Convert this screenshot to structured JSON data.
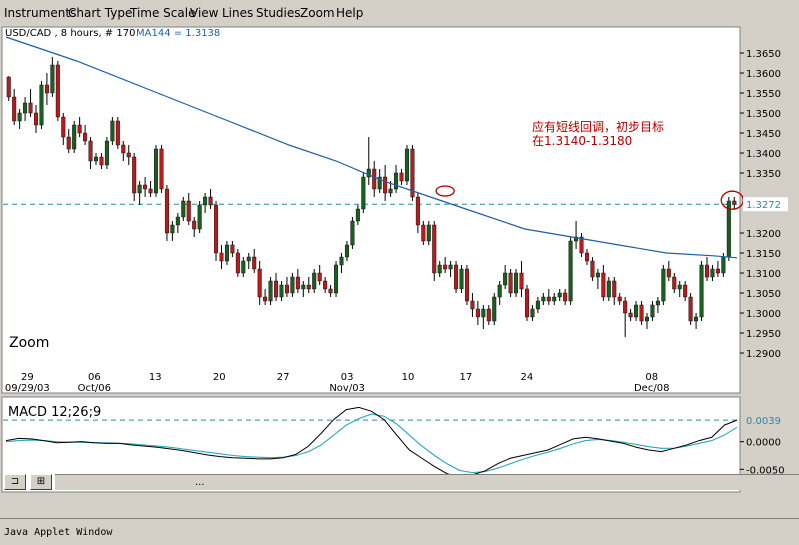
{
  "menu": [
    "Instruments",
    "Chart Type",
    "Time Scale",
    "View",
    "Lines",
    "Studies",
    "Zoom",
    "Help"
  ],
  "colors": {
    "up": "#1b5e20",
    "down": "#b71c1c",
    "wick": "#000000",
    "ma": "#1f5fa8",
    "signal": "#2aa7c0",
    "annotation": "#b00000",
    "hline": "#2a8aa0",
    "panel_bg": "#ffffff",
    "frame_bg": "#d4d0c8"
  },
  "chart_data": [
    {
      "type": "candlestick",
      "header": "USD/CAD , 8 hours, # 170",
      "ma_label": "MA144 = 1.3138",
      "zoom_label": "Zoom",
      "annotation_line1": "应有短线回调，初步目标",
      "annotation_line2": "在1.3140-1.3180",
      "ylim": [
        1.2865,
        1.37
      ],
      "yticks": [
        "1.3650",
        "1.3600",
        "1.3550",
        "1.3500",
        "1.3450",
        "1.3400",
        "1.3350",
        "1.3200",
        "1.3150",
        "1.3100",
        "1.3050",
        "1.3000",
        "1.2950",
        "1.2900"
      ],
      "last_price": 1.3272,
      "last_price_label": "1.3272",
      "x_day_labels": [
        "29",
        "06",
        "13",
        "20",
        "27",
        "03",
        "10",
        "17",
        "24",
        "08"
      ],
      "x_month_labels": [
        "09/29/03",
        "Oct/06",
        "Nov/03",
        "Dec/08"
      ],
      "candles": [
        [
          1.359,
          1.3592,
          1.353,
          1.354
        ],
        [
          1.354,
          1.356,
          1.347,
          1.348
        ],
        [
          1.348,
          1.351,
          1.346,
          1.35
        ],
        [
          1.35,
          1.354,
          1.348,
          1.3525
        ],
        [
          1.3525,
          1.356,
          1.349,
          1.35
        ],
        [
          1.35,
          1.352,
          1.345,
          1.347
        ],
        [
          1.347,
          1.358,
          1.346,
          1.357
        ],
        [
          1.357,
          1.36,
          1.352,
          1.355
        ],
        [
          1.355,
          1.364,
          1.354,
          1.362
        ],
        [
          1.362,
          1.363,
          1.348,
          1.349
        ],
        [
          1.349,
          1.35,
          1.342,
          1.344
        ],
        [
          1.344,
          1.346,
          1.34,
          1.341
        ],
        [
          1.341,
          1.348,
          1.34,
          1.347
        ],
        [
          1.347,
          1.349,
          1.344,
          1.345
        ],
        [
          1.345,
          1.347,
          1.342,
          1.343
        ],
        [
          1.343,
          1.344,
          1.336,
          1.338
        ],
        [
          1.338,
          1.34,
          1.337,
          1.339
        ],
        [
          1.339,
          1.34,
          1.336,
          1.337
        ],
        [
          1.337,
          1.344,
          1.336,
          1.343
        ],
        [
          1.343,
          1.349,
          1.342,
          1.348
        ],
        [
          1.348,
          1.349,
          1.341,
          1.342
        ],
        [
          1.342,
          1.343,
          1.338,
          1.34
        ],
        [
          1.34,
          1.342,
          1.337,
          1.339
        ],
        [
          1.339,
          1.34,
          1.328,
          1.33
        ],
        [
          1.33,
          1.333,
          1.327,
          1.332
        ],
        [
          1.332,
          1.334,
          1.329,
          1.331
        ],
        [
          1.331,
          1.333,
          1.329,
          1.33
        ],
        [
          1.33,
          1.342,
          1.329,
          1.341
        ],
        [
          1.341,
          1.342,
          1.33,
          1.331
        ],
        [
          1.331,
          1.332,
          1.318,
          1.32
        ],
        [
          1.32,
          1.323,
          1.318,
          1.322
        ],
        [
          1.322,
          1.325,
          1.32,
          1.324
        ],
        [
          1.324,
          1.329,
          1.323,
          1.328
        ],
        [
          1.328,
          1.33,
          1.322,
          1.323
        ],
        [
          1.323,
          1.324,
          1.319,
          1.321
        ],
        [
          1.321,
          1.328,
          1.32,
          1.327
        ],
        [
          1.327,
          1.33,
          1.325,
          1.329
        ],
        [
          1.329,
          1.331,
          1.326,
          1.327
        ],
        [
          1.327,
          1.328,
          1.313,
          1.315
        ],
        [
          1.315,
          1.317,
          1.311,
          1.313
        ],
        [
          1.313,
          1.318,
          1.312,
          1.317
        ],
        [
          1.317,
          1.318,
          1.314,
          1.315
        ],
        [
          1.315,
          1.316,
          1.309,
          1.31
        ],
        [
          1.31,
          1.314,
          1.309,
          1.313
        ],
        [
          1.313,
          1.315,
          1.311,
          1.314
        ],
        [
          1.314,
          1.316,
          1.31,
          1.311
        ],
        [
          1.311,
          1.313,
          1.302,
          1.304
        ],
        [
          1.304,
          1.306,
          1.302,
          1.303
        ],
        [
          1.303,
          1.309,
          1.302,
          1.308
        ],
        [
          1.308,
          1.31,
          1.303,
          1.304
        ],
        [
          1.304,
          1.308,
          1.303,
          1.307
        ],
        [
          1.307,
          1.309,
          1.304,
          1.305
        ],
        [
          1.305,
          1.31,
          1.304,
          1.309
        ],
        [
          1.309,
          1.311,
          1.305,
          1.306
        ],
        [
          1.306,
          1.308,
          1.304,
          1.307
        ],
        [
          1.307,
          1.309,
          1.305,
          1.306
        ],
        [
          1.306,
          1.311,
          1.305,
          1.31
        ],
        [
          1.31,
          1.312,
          1.307,
          1.308
        ],
        [
          1.308,
          1.309,
          1.305,
          1.306
        ],
        [
          1.306,
          1.307,
          1.304,
          1.305
        ],
        [
          1.305,
          1.313,
          1.304,
          1.312
        ],
        [
          1.312,
          1.315,
          1.31,
          1.314
        ],
        [
          1.314,
          1.318,
          1.313,
          1.317
        ],
        [
          1.317,
          1.324,
          1.316,
          1.323
        ],
        [
          1.323,
          1.327,
          1.322,
          1.326
        ],
        [
          1.326,
          1.335,
          1.325,
          1.334
        ],
        [
          1.334,
          1.344,
          1.332,
          1.336
        ],
        [
          1.336,
          1.338,
          1.329,
          1.331
        ],
        [
          1.331,
          1.336,
          1.33,
          1.334
        ],
        [
          1.334,
          1.337,
          1.328,
          1.33
        ],
        [
          1.33,
          1.333,
          1.329,
          1.331
        ],
        [
          1.331,
          1.337,
          1.33,
          1.335
        ],
        [
          1.335,
          1.336,
          1.332,
          1.333
        ],
        [
          1.333,
          1.342,
          1.332,
          1.341
        ],
        [
          1.341,
          1.342,
          1.328,
          1.329
        ],
        [
          1.329,
          1.33,
          1.32,
          1.322
        ],
        [
          1.322,
          1.323,
          1.317,
          1.318
        ],
        [
          1.318,
          1.323,
          1.317,
          1.322
        ],
        [
          1.322,
          1.323,
          1.308,
          1.31
        ],
        [
          1.31,
          1.313,
          1.309,
          1.312
        ],
        [
          1.312,
          1.314,
          1.31,
          1.311
        ],
        [
          1.311,
          1.313,
          1.309,
          1.312
        ],
        [
          1.312,
          1.313,
          1.305,
          1.306
        ],
        [
          1.306,
          1.312,
          1.305,
          1.311
        ],
        [
          1.311,
          1.312,
          1.302,
          1.303
        ],
        [
          1.303,
          1.305,
          1.299,
          1.301
        ],
        [
          1.301,
          1.303,
          1.297,
          1.299
        ],
        [
          1.299,
          1.302,
          1.296,
          1.301
        ],
        [
          1.301,
          1.302,
          1.297,
          1.298
        ],
        [
          1.298,
          1.305,
          1.297,
          1.304
        ],
        [
          1.304,
          1.308,
          1.302,
          1.307
        ],
        [
          1.307,
          1.312,
          1.306,
          1.31
        ],
        [
          1.31,
          1.311,
          1.304,
          1.305
        ],
        [
          1.305,
          1.311,
          1.304,
          1.31
        ],
        [
          1.31,
          1.313,
          1.304,
          1.306
        ],
        [
          1.306,
          1.307,
          1.298,
          1.299
        ],
        [
          1.299,
          1.302,
          1.298,
          1.301
        ],
        [
          1.301,
          1.304,
          1.3,
          1.303
        ],
        [
          1.303,
          1.305,
          1.302,
          1.304
        ],
        [
          1.304,
          1.306,
          1.302,
          1.303
        ],
        [
          1.303,
          1.305,
          1.302,
          1.304
        ],
        [
          1.304,
          1.306,
          1.303,
          1.305
        ],
        [
          1.305,
          1.306,
          1.302,
          1.303
        ],
        [
          1.303,
          1.319,
          1.302,
          1.318
        ],
        [
          1.318,
          1.323,
          1.316,
          1.319
        ],
        [
          1.319,
          1.32,
          1.314,
          1.315
        ],
        [
          1.315,
          1.316,
          1.312,
          1.313
        ],
        [
          1.313,
          1.314,
          1.308,
          1.309
        ],
        [
          1.309,
          1.311,
          1.306,
          1.31
        ],
        [
          1.31,
          1.312,
          1.303,
          1.304
        ],
        [
          1.304,
          1.309,
          1.303,
          1.308
        ],
        [
          1.308,
          1.309,
          1.302,
          1.304
        ],
        [
          1.304,
          1.305,
          1.302,
          1.303
        ],
        [
          1.303,
          1.304,
          1.294,
          1.3
        ],
        [
          1.3,
          1.301,
          1.298,
          1.299
        ],
        [
          1.299,
          1.303,
          1.298,
          1.302
        ],
        [
          1.302,
          1.303,
          1.297,
          1.298
        ],
        [
          1.298,
          1.3,
          1.296,
          1.299
        ],
        [
          1.299,
          1.303,
          1.298,
          1.302
        ],
        [
          1.302,
          1.304,
          1.3,
          1.303
        ],
        [
          1.303,
          1.312,
          1.302,
          1.311
        ],
        [
          1.311,
          1.313,
          1.308,
          1.309
        ],
        [
          1.309,
          1.31,
          1.305,
          1.306
        ],
        [
          1.306,
          1.308,
          1.304,
          1.307
        ],
        [
          1.307,
          1.308,
          1.303,
          1.304
        ],
        [
          1.304,
          1.305,
          1.297,
          1.298
        ],
        [
          1.298,
          1.3,
          1.296,
          1.299
        ],
        [
          1.299,
          1.313,
          1.298,
          1.312
        ],
        [
          1.312,
          1.314,
          1.308,
          1.309
        ],
        [
          1.309,
          1.312,
          1.308,
          1.311
        ],
        [
          1.311,
          1.313,
          1.309,
          1.31
        ],
        [
          1.31,
          1.315,
          1.309,
          1.314
        ],
        [
          1.314,
          1.329,
          1.313,
          1.328
        ],
        [
          1.328,
          1.329,
          1.326,
          1.3272
        ]
      ],
      "ma144": [
        [
          0,
          1.369
        ],
        [
          30,
          1.363
        ],
        [
          60,
          1.356
        ],
        [
          90,
          1.349
        ],
        [
          120,
          1.342
        ],
        [
          140,
          1.338
        ],
        [
          160,
          1.333
        ],
        [
          180,
          1.329
        ],
        [
          200,
          1.325
        ],
        [
          220,
          1.321
        ],
        [
          240,
          1.319
        ],
        [
          260,
          1.317
        ],
        [
          280,
          1.315
        ],
        [
          300,
          1.3143
        ],
        [
          310,
          1.3138
        ]
      ]
    },
    {
      "type": "line",
      "title": "MACD 12;26;9",
      "ylim": [
        -0.0082,
        0.007
      ],
      "yticks": [
        "0.0000",
        "-0.0050"
      ],
      "last_value_label": "0.0039",
      "last_value": 0.0039,
      "macd": [
        0.0002,
        0.0006,
        0.0005,
        0.0002,
        -0.0002,
        -0.0001,
        0.0,
        -0.0002,
        -0.0003,
        -0.0003,
        -0.0006,
        -0.0008,
        -0.001,
        -0.0013,
        -0.0016,
        -0.002,
        -0.0024,
        -0.0027,
        -0.0029,
        -0.003,
        -0.0031,
        -0.0031,
        -0.0029,
        -0.0023,
        -0.0008,
        0.0015,
        0.004,
        0.0058,
        0.0062,
        0.0055,
        0.004,
        0.0012,
        -0.0015,
        -0.003,
        -0.0045,
        -0.0058,
        -0.0064,
        -0.006,
        -0.0053,
        -0.004,
        -0.003,
        -0.0025,
        -0.002,
        -0.0015,
        -0.0005,
        0.0005,
        0.0008,
        0.0005,
        0.0001,
        -0.0003,
        -0.001,
        -0.0015,
        -0.0018,
        -0.0012,
        -0.0006,
        0.0002,
        0.0008,
        0.003,
        0.0039
      ],
      "signal": [
        0.0,
        0.0002,
        0.0003,
        0.0002,
        0.0,
        -0.0001,
        -0.0001,
        -0.0002,
        -0.0002,
        -0.0003,
        -0.0004,
        -0.0006,
        -0.0008,
        -0.001,
        -0.0013,
        -0.0016,
        -0.0019,
        -0.0022,
        -0.0025,
        -0.0027,
        -0.0028,
        -0.0029,
        -0.0028,
        -0.0025,
        -0.0018,
        -0.0006,
        0.0012,
        0.003,
        0.0042,
        0.005,
        0.0046,
        0.0032,
        0.0012,
        -0.0008,
        -0.0025,
        -0.004,
        -0.0052,
        -0.0056,
        -0.0054,
        -0.0048,
        -0.004,
        -0.0032,
        -0.0025,
        -0.0019,
        -0.0012,
        -0.0004,
        0.0002,
        0.0004,
        0.0002,
        -0.0001,
        -0.0005,
        -0.0009,
        -0.0012,
        -0.0012,
        -0.0008,
        -0.0003,
        0.0002,
        0.0012,
        0.0026
      ]
    }
  ],
  "toolbar": {
    "btn1": "⊐",
    "btn2": "⊞",
    "dots": "..."
  },
  "status": {
    "text": "Java Applet Window"
  }
}
